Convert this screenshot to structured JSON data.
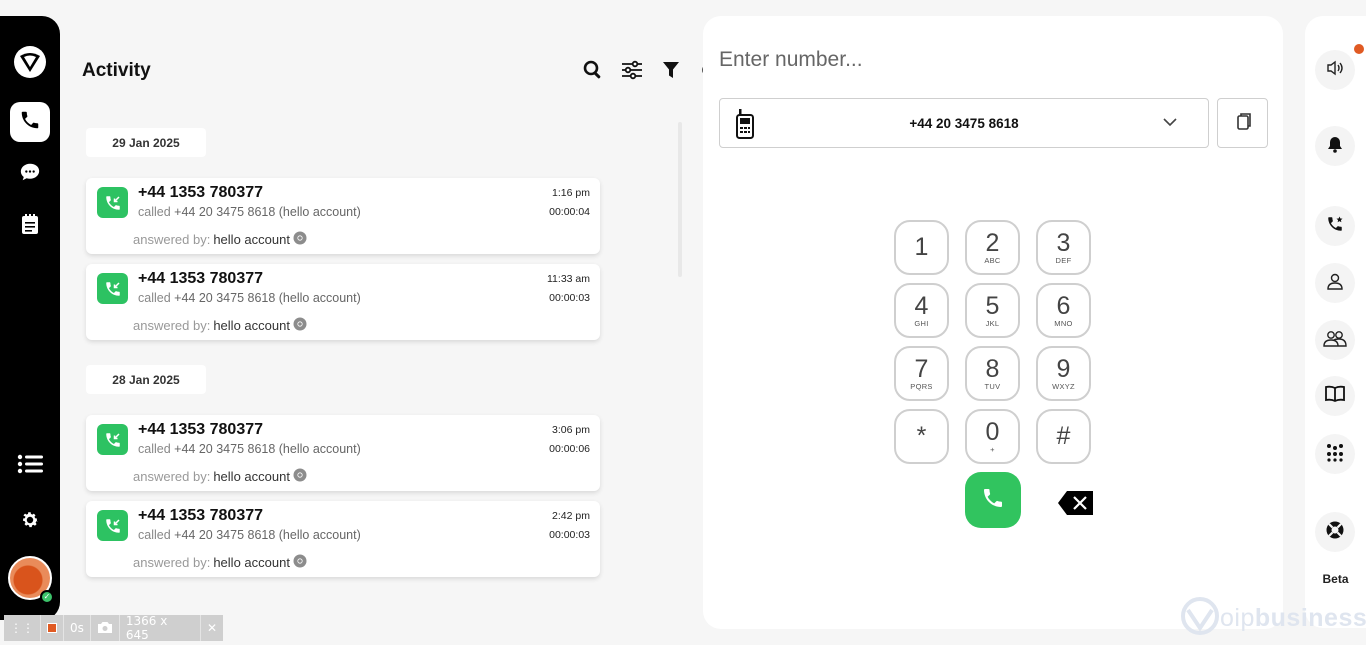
{
  "nav": {
    "items": [
      "logo-icon",
      "phone-icon",
      "chat-icon",
      "notepad-icon",
      "list-icon",
      "gear-icon"
    ],
    "presence": "✓"
  },
  "activity": {
    "title": "Activity",
    "groups": [
      {
        "date": "29 Jan 2025",
        "calls": [
          {
            "number": "+44 1353 780377",
            "called_label": "called",
            "called_to": "+44 20 3475 8618 (hello account)",
            "answered_label": "answered by:",
            "answered_by": "hello account",
            "time": "1:16 pm",
            "duration": "00:00:04"
          },
          {
            "number": "+44 1353 780377",
            "called_label": "called",
            "called_to": "+44 20 3475 8618 (hello account)",
            "answered_label": "answered by:",
            "answered_by": "hello account",
            "time": "11:33 am",
            "duration": "00:00:03"
          }
        ]
      },
      {
        "date": "28 Jan 2025",
        "calls": [
          {
            "number": "+44 1353 780377",
            "called_label": "called",
            "called_to": "+44 20 3475 8618 (hello account)",
            "answered_label": "answered by:",
            "answered_by": "hello account",
            "time": "3:06 pm",
            "duration": "00:00:06"
          },
          {
            "number": "+44 1353 780377",
            "called_label": "called",
            "called_to": "+44 20 3475 8618 (hello account)",
            "answered_label": "answered by:",
            "answered_by": "hello account",
            "time": "2:42 pm",
            "duration": "00:00:03"
          }
        ]
      }
    ]
  },
  "dialer": {
    "placeholder": "Enter number...",
    "selected_line": "+44 20 3475 8618",
    "keys": [
      {
        "digit": "1",
        "letters": ""
      },
      {
        "digit": "2",
        "letters": "ABC"
      },
      {
        "digit": "3",
        "letters": "DEF"
      },
      {
        "digit": "4",
        "letters": "GHI"
      },
      {
        "digit": "5",
        "letters": "JKL"
      },
      {
        "digit": "6",
        "letters": "MNO"
      },
      {
        "digit": "7",
        "letters": "PQRS"
      },
      {
        "digit": "8",
        "letters": "TUV"
      },
      {
        "digit": "9",
        "letters": "WXYZ"
      },
      {
        "digit": "*",
        "letters": ""
      },
      {
        "digit": "0",
        "letters": "+"
      },
      {
        "digit": "#",
        "letters": ""
      }
    ]
  },
  "rail": {
    "beta": "Beta"
  },
  "brand": {
    "prefix": "oip",
    "name": "business"
  },
  "recorder": {
    "elapsed": "0s",
    "size": "1366 x 645"
  },
  "colors": {
    "accent_green": "#2dc262",
    "nav_bg": "#000000",
    "notify_dot": "#e05a23"
  }
}
